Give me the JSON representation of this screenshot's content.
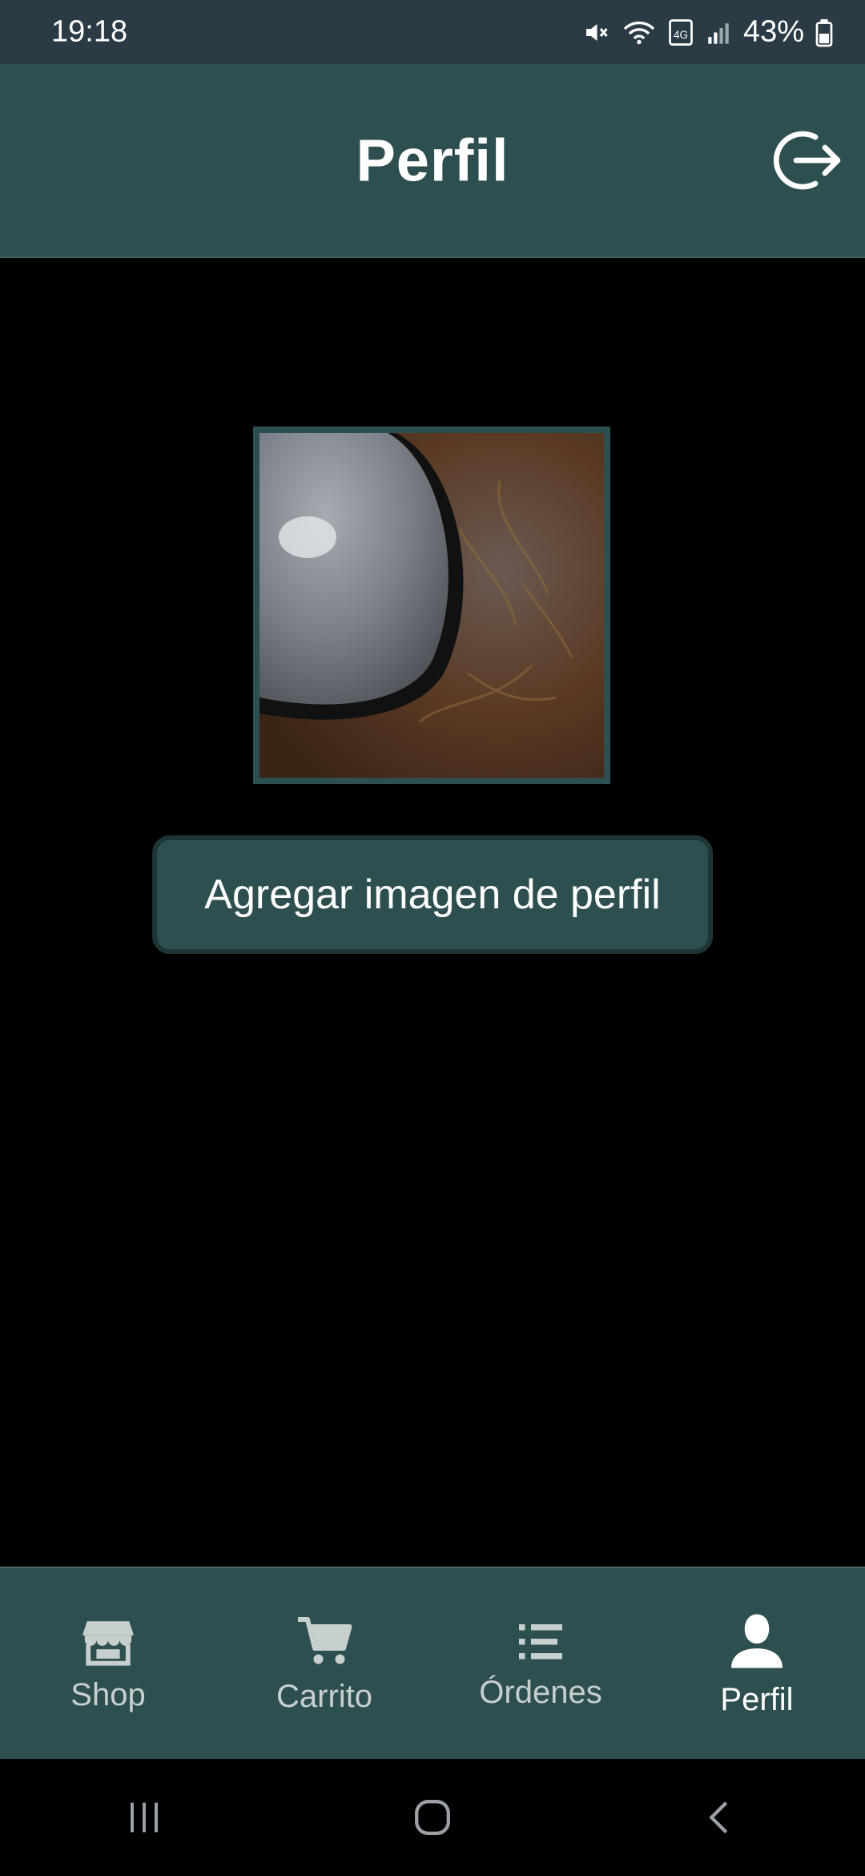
{
  "status_bar": {
    "time": "19:18",
    "network_label": "4G",
    "battery": "43%"
  },
  "header": {
    "title": "Perfil",
    "logout_icon": "logout-icon"
  },
  "profile": {
    "image_icon": "profile-photo",
    "add_image_label": "Agregar imagen de perfil"
  },
  "bottom_nav": {
    "items": [
      {
        "label": "Shop",
        "icon": "store-icon",
        "active": false
      },
      {
        "label": "Carrito",
        "icon": "cart-icon",
        "active": false
      },
      {
        "label": "Órdenes",
        "icon": "list-icon",
        "active": false
      },
      {
        "label": "Perfil",
        "icon": "person-icon",
        "active": true
      }
    ]
  },
  "colors": {
    "app_bar": "#2e4f50",
    "status_bar": "#2a3b46",
    "background": "#000000",
    "inactive_label": "#c7cfcf"
  }
}
